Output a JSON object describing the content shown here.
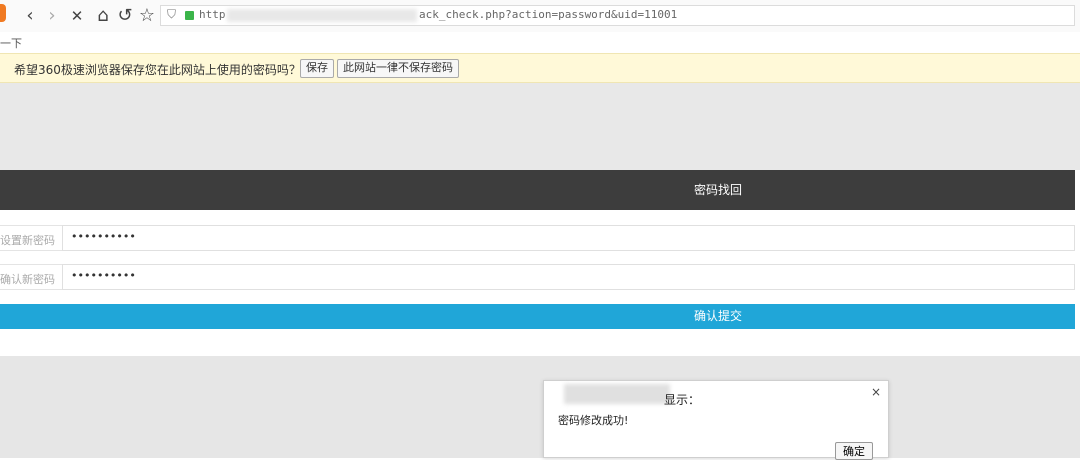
{
  "browser": {
    "url_left": "http",
    "url_right": "ack_check.php?action=password&uid=11001",
    "icons": [
      "back-icon",
      "forward-icon",
      "close-icon",
      "home-icon",
      "reload-icon",
      "star-icon",
      "shield-icon",
      "lock-icon"
    ],
    "glyphs": {
      "back": "‹",
      "forward": "›",
      "close": "✕",
      "home": "⌂",
      "reload": "↺",
      "star": "☆",
      "shield": "⛉"
    }
  },
  "sub_text": "一下",
  "password_prompt": {
    "message": "希望360极速浏览器保存您在此网站上使用的密码吗？",
    "save_label": "保存",
    "never_label": "此网站一律不保存密码"
  },
  "page": {
    "header_title": "密码找回",
    "new_password_label": "设置新密码",
    "new_password_value": "••••••••••",
    "confirm_password_label": "确认新密码",
    "confirm_password_value": "••••••••••",
    "submit_label": "确认提交"
  },
  "alert": {
    "title": "显示：",
    "message": "密码修改成功!",
    "ok_label": "确定",
    "close": "×"
  },
  "colors": {
    "header_bg": "#3d3d3d",
    "submit_bg": "#20a6d8",
    "prompt_bg": "#fff9d8"
  }
}
